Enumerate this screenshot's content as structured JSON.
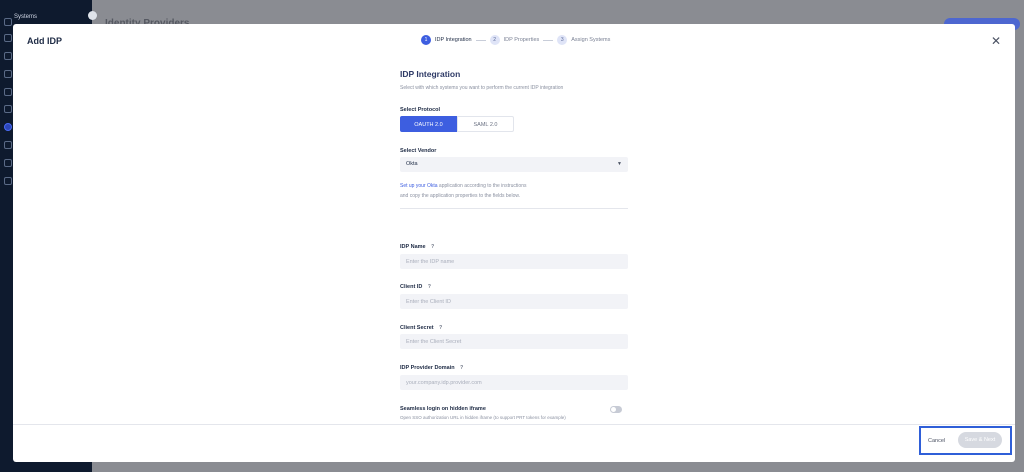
{
  "background": {
    "sidebar_brand": "Systems",
    "page_title": "Identity Providers"
  },
  "modal": {
    "title": "Add IDP",
    "close_icon": "close-icon"
  },
  "stepper": {
    "steps": [
      {
        "num": "1",
        "label": "IDP Integration",
        "active": true
      },
      {
        "num": "2",
        "label": "IDP Properties",
        "active": false
      },
      {
        "num": "3",
        "label": "Assign Systems",
        "active": false
      }
    ]
  },
  "form": {
    "title": "IDP Integration",
    "subtitle": "Select with which systems you want to perform the current IDP integration",
    "protocol": {
      "label": "Select Protocol",
      "options": [
        "OAUTH 2.0",
        "SAML 2.0"
      ],
      "selected": "OAUTH 2.0"
    },
    "vendor": {
      "label": "Select Vendor",
      "value": "Okta"
    },
    "vendor_note": {
      "link": "Set up your Okta",
      "text1": " application according to the instructions",
      "text2": "and copy the application properties to the fields below."
    },
    "fields": {
      "idp_name": {
        "label": "IDP Name",
        "help": "?",
        "placeholder": "Enter the IDP name"
      },
      "client_id": {
        "label": "Client ID",
        "help": "?",
        "placeholder": "Enter the Client ID"
      },
      "client_secret": {
        "label": "Client Secret",
        "help": "?",
        "placeholder": "Enter the Client Secret"
      },
      "idp_domain": {
        "label": "IDP Provider Domain",
        "help": "?",
        "placeholder": "your.company.idp.provider.com"
      }
    },
    "seamless": {
      "label": "Seamless login on hidden iframe",
      "description": "Open SSO authorization URL in hidden iframe (to support PRT tokens for example)",
      "enabled": false
    }
  },
  "footer": {
    "cancel_label": "Cancel",
    "save_label": "Save & Next"
  },
  "colors": {
    "accent": "#3d5ee0",
    "highlight_box": "#2f5fd8"
  }
}
